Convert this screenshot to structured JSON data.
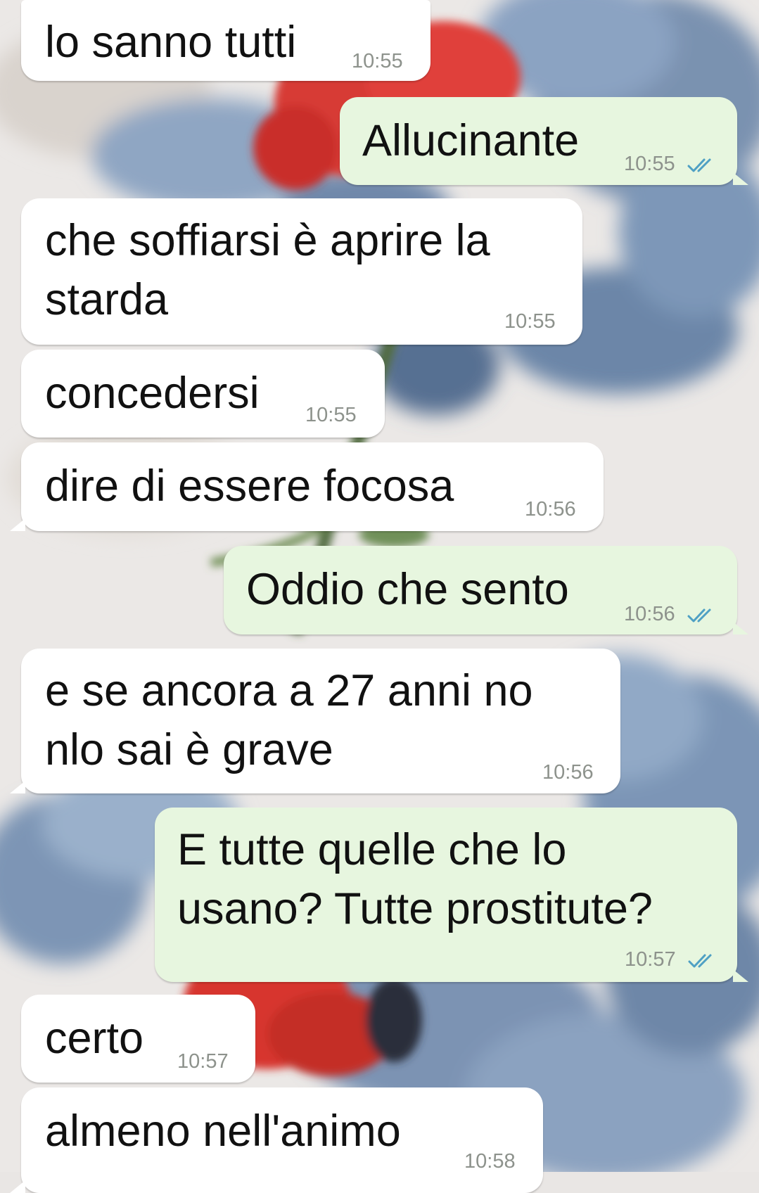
{
  "colors": {
    "incoming_bubble": "#ffffff",
    "outgoing_bubble": "#e7f6df",
    "read_ticks": "#4fa0c4",
    "timestamp": "#8d928c"
  },
  "messages": [
    {
      "direction": "incoming",
      "lines": [
        "lo sanno tutti"
      ],
      "time": "10:55"
    },
    {
      "direction": "outgoing",
      "lines": [
        "Allucinante"
      ],
      "time": "10:55",
      "status": "read-double-check-icon"
    },
    {
      "direction": "incoming",
      "lines": [
        "che soffiarsi è aprire la",
        "starda"
      ],
      "time": "10:55"
    },
    {
      "direction": "incoming",
      "lines": [
        "concedersi"
      ],
      "time": "10:55"
    },
    {
      "direction": "incoming",
      "lines": [
        "dire di essere focosa"
      ],
      "time": "10:56"
    },
    {
      "direction": "outgoing",
      "lines": [
        "Oddio che sento"
      ],
      "time": "10:56",
      "status": "read-double-check-icon"
    },
    {
      "direction": "incoming",
      "lines": [
        "e se ancora a 27 anni no",
        "nlo sai è grave"
      ],
      "time": "10:56"
    },
    {
      "direction": "outgoing",
      "lines": [
        "E tutte quelle che lo",
        "usano? Tutte prostitute?"
      ],
      "time": "10:57",
      "status": "read-double-check-icon"
    },
    {
      "direction": "incoming",
      "lines": [
        "certo"
      ],
      "time": "10:57"
    },
    {
      "direction": "incoming",
      "lines": [
        "almeno nell'animo"
      ],
      "time": "10:58"
    }
  ]
}
